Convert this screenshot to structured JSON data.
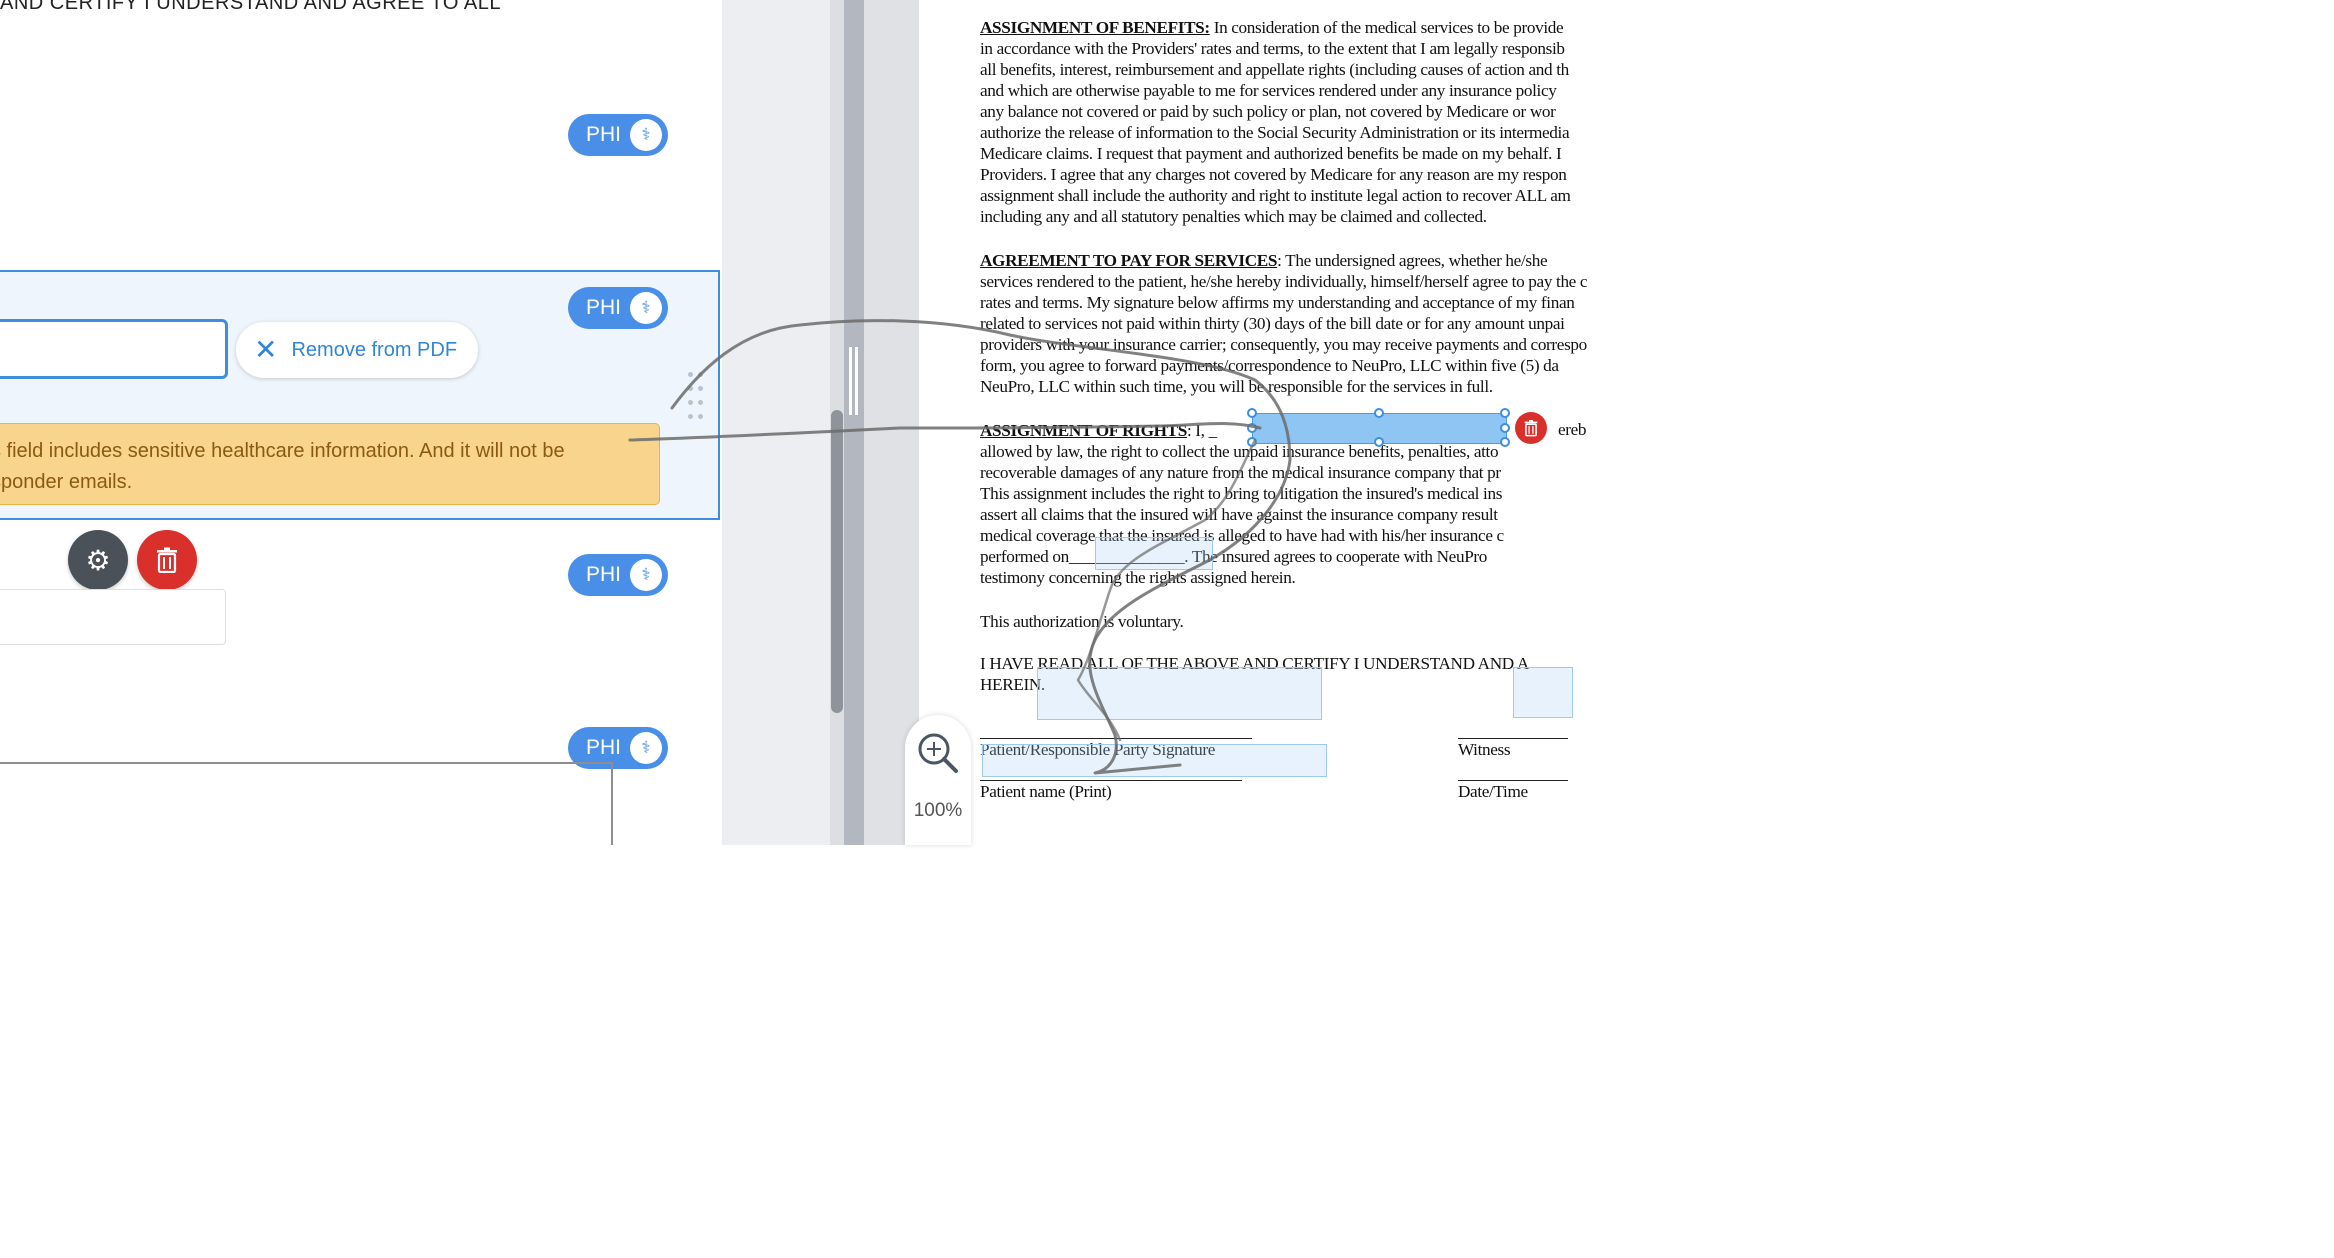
{
  "left_panel": {
    "top_text": "AND CERTIFY I UNDERSTAND AND AGREE TO ALL",
    "phi_label": "PHI",
    "phi_icon": "caduceus-icon",
    "remove_button_label": "Remove from PDF",
    "warning_line1": "s field includes sensitive healthcare information. And it will not be",
    "warning_line2": "sponder emails.",
    "accent_color": "#4a8fe7",
    "warning_color": "#f8d48c",
    "delete_color": "#d9302c"
  },
  "document": {
    "p1": [
      {
        "h": "ASSIGNMENT OF BENEFITS:",
        "t": " In consideration of the medical services to be provide"
      },
      {
        "t": "in accordance with the Providers' rates and terms, to the extent that I am legally responsib"
      },
      {
        "t": "all benefits, interest, reimbursement and appellate rights (including causes of action and th"
      },
      {
        "t": "and which are otherwise payable to me for services rendered under any insurance policy"
      },
      {
        "t": "any balance not covered or paid by such policy or plan, not covered by Medicare or wor"
      },
      {
        "t": "authorize the release of information to the Social Security Administration or its intermedia"
      },
      {
        "t": "Medicare claims. I request that payment and authorized benefits be made on my behalf. I"
      },
      {
        "t": "Providers. I agree that any charges not covered by Medicare for any reason are my respon"
      },
      {
        "t": "assignment shall include the authority and right to institute legal action to recover ALL am"
      },
      {
        "t": "including any and all statutory penalties which may be claimed and collected."
      }
    ],
    "p2": [
      {
        "h": "AGREEMENT TO PAY FOR SERVICES",
        "t": ": The undersigned agrees, whether he/she"
      },
      {
        "t": "services rendered to the patient, he/she hereby individually, himself/herself agree to pay the c"
      },
      {
        "t": "rates and terms. My signature below affirms my understanding and acceptance of my finan"
      },
      {
        "t": "related to services not paid within thirty (30) days of the bill date or for any amount unpai"
      },
      {
        "t": "providers with your insurance carrier; consequently, you may receive payments and correspo"
      },
      {
        "t": "form, you agree to forward payments/correspondence to NeuPro, LLC within five (5) da"
      },
      {
        "t": "NeuPro, LLC within such time, you will be responsible for the services in full."
      }
    ],
    "p3": [
      {
        "h": "ASSIGNMENT OF RIGHTS",
        "t": ": I, _"
      },
      {
        "t": "allowed by law, the right to collect the unpaid insurance benefits, penalties, atto"
      },
      {
        "t": "recoverable damages of any nature from the medical insurance company that pr"
      },
      {
        "t": "This assignment includes the right to bring to litigation the insured's medical ins"
      },
      {
        "t": "assert all claims that the insured will have against the insurance company result"
      },
      {
        "t": "medical coverage that the insured is alleged to have had with his/her insurance c"
      },
      {
        "t": "performed on______________. The insured agrees to cooperate with NeuPro"
      },
      {
        "t": "testimony concerning the rights assigned herein."
      }
    ],
    "p3_tail": "ereb",
    "voluntary": "This authorization is voluntary.",
    "certify_line1": "I HAVE READ ALL OF THE ABOVE AND CERTIFY I UNDERSTAND AND A",
    "certify_line2": "HEREIN.",
    "sig_label": "Patient/Responsible Party Signature",
    "witness_label": "Witness",
    "name_label": "Patient name (Print)",
    "datetime_label": "Date/Time"
  },
  "zoom": {
    "level": "100%",
    "icon": "zoom-in-icon"
  }
}
